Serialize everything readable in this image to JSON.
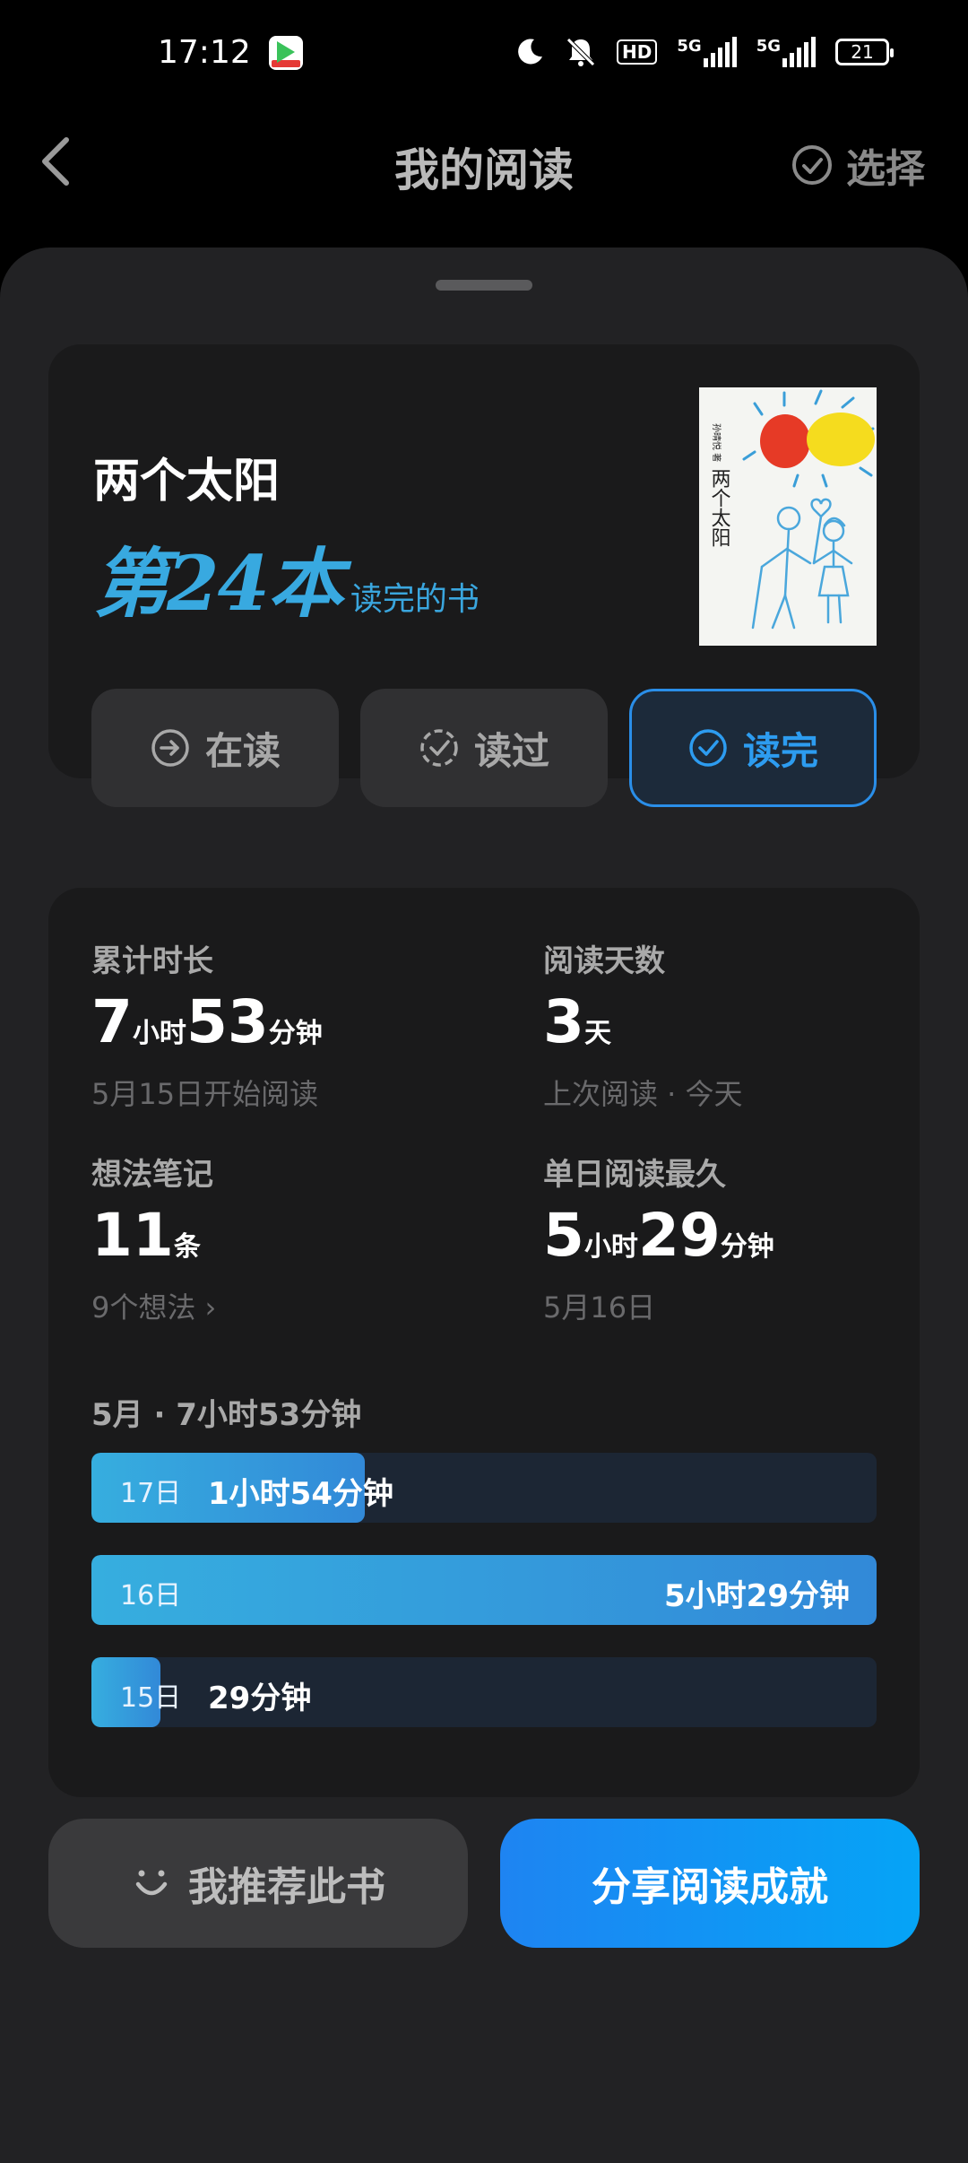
{
  "status_bar": {
    "time": "17:12",
    "battery": "21",
    "network1": "5G",
    "network2": "5G",
    "hd": "HD"
  },
  "header": {
    "title": "我的阅读",
    "select_label": "选择"
  },
  "book": {
    "title": "两个太阳",
    "rank_number": "第24本",
    "rank_suffix": "读完的书",
    "cover_title": "两个太阳",
    "cover_author": "孙晴悦 著",
    "status_buttons": [
      {
        "label": "在读",
        "icon": "arrow-circle-icon",
        "active": false
      },
      {
        "label": "读过",
        "icon": "dashed-check-icon",
        "active": false
      },
      {
        "label": "读完",
        "icon": "check-circle-icon",
        "active": true
      }
    ]
  },
  "stats": {
    "total_time": {
      "label": "累计时长",
      "hours": "7",
      "hour_unit": "小时",
      "minutes": "53",
      "minute_unit": "分钟",
      "note": "5月15日开始阅读"
    },
    "days": {
      "label": "阅读天数",
      "value": "3",
      "unit": "天",
      "note": "上次阅读 · 今天"
    },
    "notes": {
      "label": "想法笔记",
      "value": "11",
      "unit": "条",
      "note": "9个想法",
      "note_chevron": "›"
    },
    "longest_day": {
      "label": "单日阅读最久",
      "hours": "5",
      "hour_unit": "小时",
      "minutes": "29",
      "minute_unit": "分钟",
      "note": "5月16日"
    }
  },
  "month_summary": "5月 · 7小时53分钟",
  "daily_bars": [
    {
      "day": "17日",
      "duration": "1小时54分钟",
      "fraction": 0.348
    },
    {
      "day": "16日",
      "duration": "5小时29分钟",
      "fraction": 1.0
    },
    {
      "day": "15日",
      "duration": "29分钟",
      "fraction": 0.088
    }
  ],
  "actions": {
    "recommend": "我推荐此书",
    "share": "分享阅读成就"
  },
  "colors": {
    "accent": "#2d9cf0",
    "bar_fill": "#36aedf",
    "background": "#222224"
  }
}
